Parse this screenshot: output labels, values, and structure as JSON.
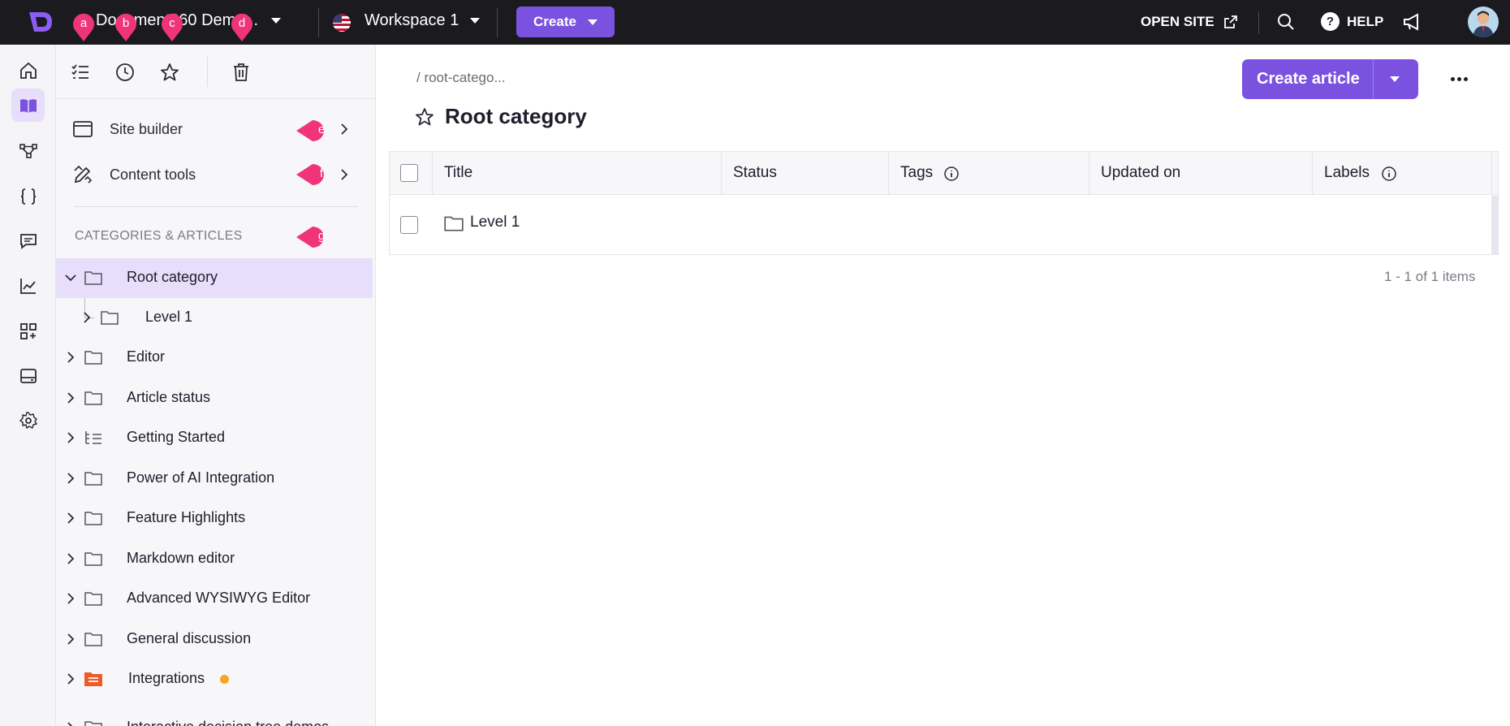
{
  "topbar": {
    "project_name": "Document360 Demo...",
    "workspace": "Workspace 1",
    "create_label": "Create",
    "open_site_label": "OPEN SITE",
    "help_label": "HELP",
    "help_glyph": "?"
  },
  "rail": {
    "items": [
      {
        "icon": "home-icon"
      },
      {
        "icon": "book-icon",
        "active": true
      },
      {
        "icon": "workflow-icon"
      },
      {
        "icon": "code-braces-icon"
      },
      {
        "icon": "comment-icon"
      },
      {
        "icon": "analytics-icon"
      },
      {
        "icon": "apps-add-icon"
      },
      {
        "icon": "drive-icon"
      },
      {
        "icon": "settings-icon"
      }
    ]
  },
  "sidebar": {
    "tools": [
      "checklist-icon",
      "clock-icon",
      "star-icon",
      "trash-icon"
    ],
    "site_builder_label": "Site builder",
    "content_tools_label": "Content tools",
    "categories_heading": "CATEGORIES & ARTICLES",
    "tree": [
      {
        "label": "Root category",
        "selected": true,
        "expanded": true
      },
      {
        "label": "Level 1",
        "child": true
      },
      {
        "label": "Editor"
      },
      {
        "label": "Article status"
      },
      {
        "label": "Getting Started",
        "icon": "list-tree-icon"
      },
      {
        "label": "Power of AI Integration"
      },
      {
        "label": "Feature Highlights"
      },
      {
        "label": "Markdown editor"
      },
      {
        "label": "Advanced WYSIWYG Editor"
      },
      {
        "label": "General discussion"
      },
      {
        "label": "Integrations",
        "icon": "colored-folder-icon",
        "dot": true
      },
      {
        "label": "Interactive decision tree demos"
      }
    ]
  },
  "callouts": {
    "a": "a",
    "b": "b",
    "c": "c",
    "d": "d",
    "e": "e",
    "f": "f",
    "g": "g"
  },
  "main": {
    "breadcrumb": "/ root-catego...",
    "title": "Root category",
    "create_article_label": "Create article",
    "columns": {
      "title": "Title",
      "status": "Status",
      "tags": "Tags",
      "updated_on": "Updated on",
      "labels": "Labels"
    },
    "rows": [
      {
        "title": "Level 1"
      }
    ],
    "pager": "1 - 1 of 1 items"
  },
  "colors": {
    "accent": "#7b52e0",
    "selected_bg": "#e6defb",
    "callout": "#f0347a",
    "topbar": "#1a1a1f"
  }
}
